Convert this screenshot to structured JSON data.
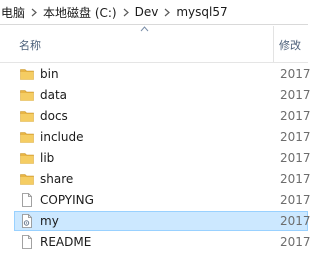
{
  "breadcrumb": {
    "items": [
      "电脑",
      "本地磁盘 (C:)",
      "Dev",
      "mysql57"
    ]
  },
  "columns": {
    "name": "名称",
    "date": "修改"
  },
  "files": [
    {
      "name": "bin",
      "type": "folder",
      "date": "2017"
    },
    {
      "name": "data",
      "type": "folder",
      "date": "2017"
    },
    {
      "name": "docs",
      "type": "folder",
      "date": "2017"
    },
    {
      "name": "include",
      "type": "folder",
      "date": "2017"
    },
    {
      "name": "lib",
      "type": "folder",
      "date": "2017"
    },
    {
      "name": "share",
      "type": "folder",
      "date": "2017"
    },
    {
      "name": "COPYING",
      "type": "file",
      "date": "2017"
    },
    {
      "name": "my",
      "type": "settings-file",
      "date": "2017",
      "selected": true
    },
    {
      "name": "README",
      "type": "file",
      "date": "2017"
    }
  ],
  "colors": {
    "folder": "#e8b545",
    "selection": "#cce8ff",
    "selection_border": "#99d1ff"
  }
}
